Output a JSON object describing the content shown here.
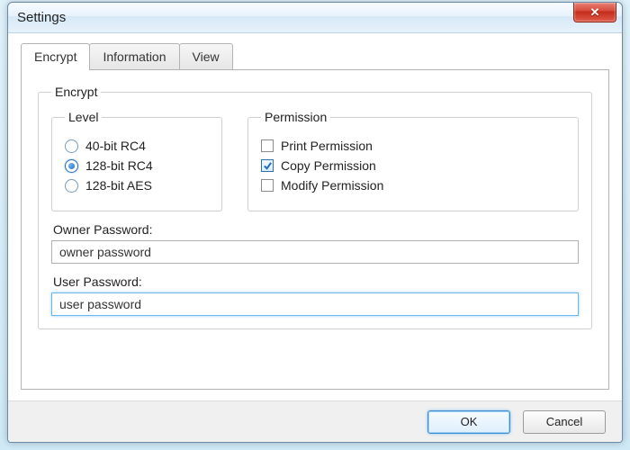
{
  "window": {
    "title": "Settings"
  },
  "tabs": [
    {
      "label": "Encrypt",
      "active": true
    },
    {
      "label": "Information",
      "active": false
    },
    {
      "label": "View",
      "active": false
    }
  ],
  "encrypt": {
    "groupLabel": "Encrypt",
    "level": {
      "groupLabel": "Level",
      "options": [
        {
          "label": "40-bit RC4",
          "checked": false
        },
        {
          "label": "128-bit RC4",
          "checked": true
        },
        {
          "label": "128-bit AES",
          "checked": false
        }
      ]
    },
    "permission": {
      "groupLabel": "Permission",
      "options": [
        {
          "label": "Print Permission",
          "checked": false
        },
        {
          "label": "Copy Permission",
          "checked": true
        },
        {
          "label": "Modify Permission",
          "checked": false
        }
      ]
    },
    "ownerPassword": {
      "label": "Owner Password:",
      "value": "owner password"
    },
    "userPassword": {
      "label": "User Password:",
      "value": "user password"
    }
  },
  "buttons": {
    "ok": "OK",
    "cancel": "Cancel"
  }
}
